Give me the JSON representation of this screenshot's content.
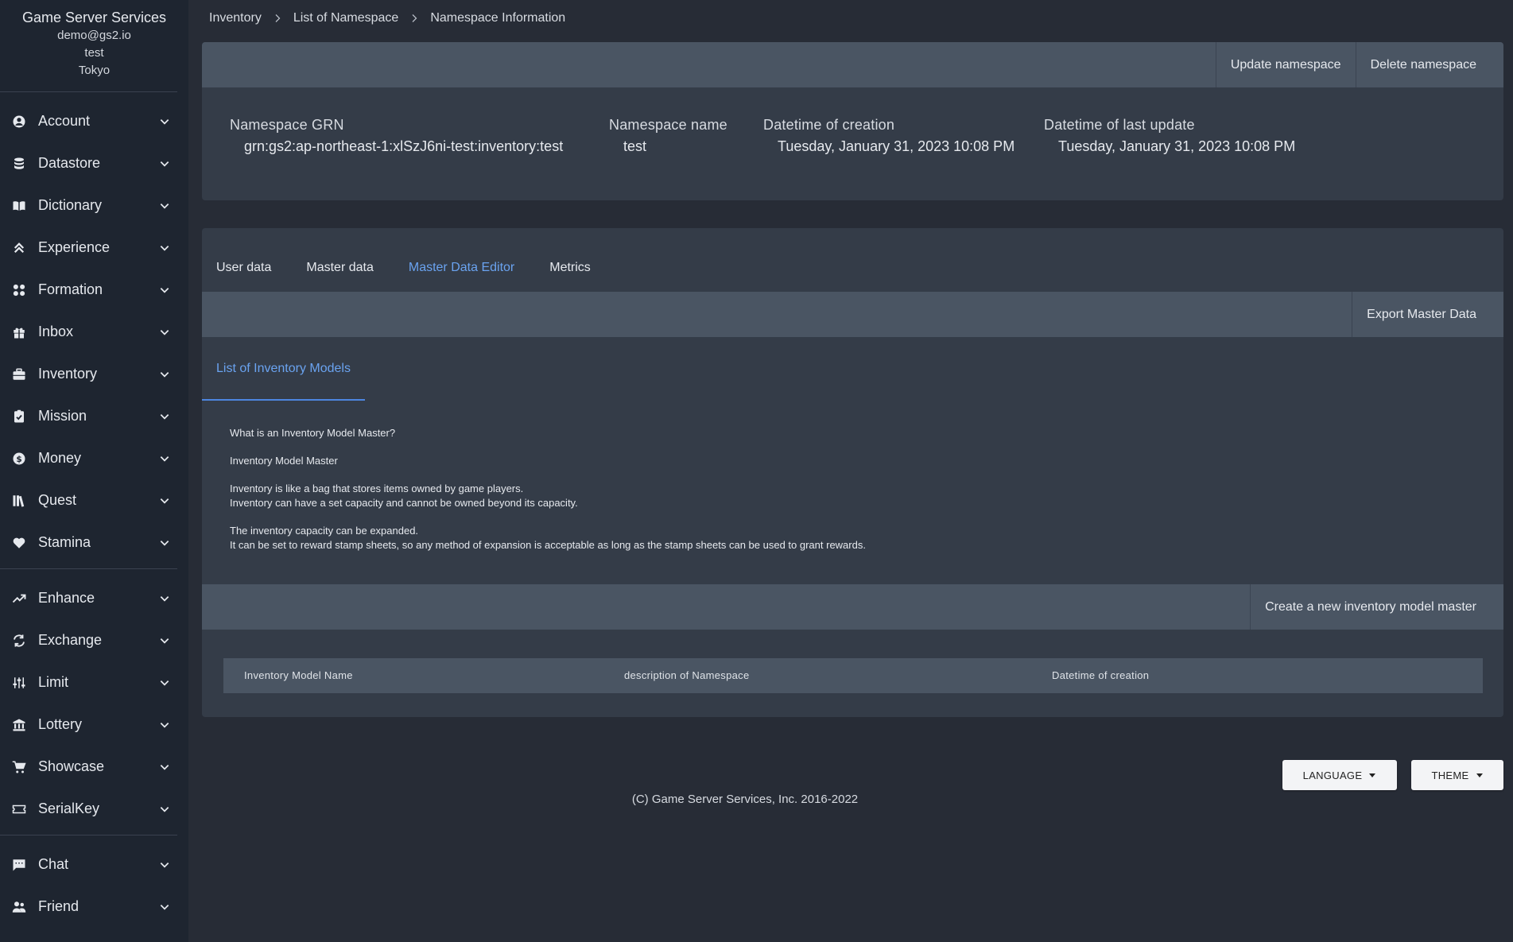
{
  "sidebar": {
    "title": "Game Server Services",
    "email": "demo@gs2.io",
    "project": "test",
    "region": "Tokyo",
    "group1": [
      {
        "label": "Account",
        "icon": "account-circle-icon"
      },
      {
        "label": "Datastore",
        "icon": "database-icon"
      },
      {
        "label": "Dictionary",
        "icon": "book-icon"
      },
      {
        "label": "Experience",
        "icon": "double-chevron-up-icon"
      },
      {
        "label": "Formation",
        "icon": "grid-dots-icon"
      },
      {
        "label": "Inbox",
        "icon": "gift-icon"
      },
      {
        "label": "Inventory",
        "icon": "briefcase-icon"
      },
      {
        "label": "Mission",
        "icon": "clipboard-check-icon"
      },
      {
        "label": "Money",
        "icon": "dollar-coin-icon"
      },
      {
        "label": "Quest",
        "icon": "books-icon"
      },
      {
        "label": "Stamina",
        "icon": "heart-icon"
      }
    ],
    "group2": [
      {
        "label": "Enhance",
        "icon": "trending-up-icon"
      },
      {
        "label": "Exchange",
        "icon": "exchange-icon"
      },
      {
        "label": "Limit",
        "icon": "sliders-icon"
      },
      {
        "label": "Lottery",
        "icon": "bank-icon"
      },
      {
        "label": "Showcase",
        "icon": "cart-icon"
      },
      {
        "label": "SerialKey",
        "icon": "ticket-icon"
      }
    ],
    "group3": [
      {
        "label": "Chat",
        "icon": "chat-icon"
      },
      {
        "label": "Friend",
        "icon": "people-icon"
      }
    ]
  },
  "breadcrumb": [
    "Inventory",
    "List of Namespace",
    "Namespace Information"
  ],
  "namespace": {
    "update_label": "Update namespace",
    "delete_label": "Delete namespace",
    "grn_label": "Namespace GRN",
    "grn_value": "grn:gs2:ap-northeast-1:xlSzJ6ni-test:inventory:test",
    "name_label": "Namespace name",
    "name_value": "test",
    "created_label": "Datetime of creation",
    "created_value": "Tuesday, January 31, 2023 10:08 PM",
    "updated_label": "Datetime of last update",
    "updated_value": "Tuesday, January 31, 2023 10:08 PM"
  },
  "tabs": [
    "User data",
    "Master data",
    "Master Data Editor",
    "Metrics"
  ],
  "active_tab": "Master Data Editor",
  "editor": {
    "export_label": "Export Master Data",
    "subtab": "List of Inventory Models",
    "desc": [
      "What is an Inventory Model Master?",
      "Inventory Model Master",
      "Inventory is like a bag that stores items owned by game players.",
      "Inventory can have a set capacity and cannot be owned beyond its capacity.",
      "The inventory capacity can be expanded.",
      "It can be set to reward stamp sheets, so any method of expansion is acceptable as long as the stamp sheets can be used to grant rewards."
    ],
    "create_label": "Create a new inventory model master",
    "columns": [
      "Inventory Model Name",
      "description of Namespace",
      "Datetime of creation"
    ]
  },
  "footer": {
    "language_label": "LANGUAGE",
    "theme_label": "THEME",
    "copyright": "(C) Game Server Services, Inc. 2016-2022"
  },
  "colors": {
    "background": "#272c36",
    "sidebar": "#1e2530",
    "panel": "#343c48",
    "toolbar": "#4a5563",
    "accent": "#6aa3f0"
  }
}
